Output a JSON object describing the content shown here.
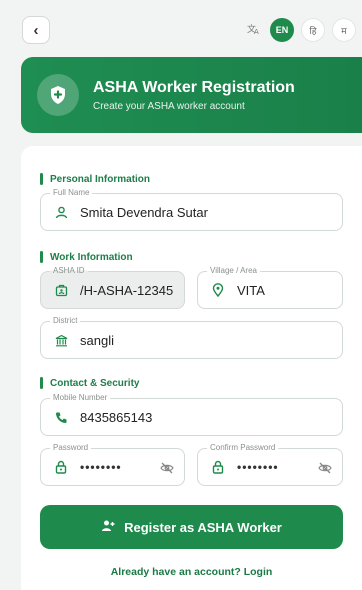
{
  "topbar": {
    "back_icon": "chevron-left-icon",
    "translate_icon": "translate-icon",
    "languages": [
      {
        "label": "EN",
        "active": true
      },
      {
        "label": "हि",
        "active": false
      },
      {
        "label": "म",
        "active": false
      }
    ]
  },
  "header": {
    "title": "ASHA Worker Registration",
    "subtitle": "Create your ASHA worker account",
    "icon": "shield-plus-icon"
  },
  "sections": {
    "personal": "Personal Information",
    "work": "Work Information",
    "contact": "Contact & Security"
  },
  "fields": {
    "full_name": {
      "label": "Full Name",
      "value": "Smita Devendra Sutar",
      "icon": "person-icon"
    },
    "asha_id": {
      "label": "ASHA ID",
      "value": "/H-ASHA-12345",
      "icon": "id-badge-icon"
    },
    "village": {
      "label": "Village / Area",
      "value": "VITA",
      "icon": "location-pin-icon"
    },
    "district": {
      "label": "District",
      "value": "sangli",
      "icon": "building-icon"
    },
    "mobile": {
      "label": "Mobile Number",
      "value": "8435865143",
      "icon": "phone-icon"
    },
    "password": {
      "label": "Password",
      "value": "••••••••",
      "icon": "lock-icon"
    },
    "confirm_password": {
      "label": "Confirm Password",
      "value": "••••••••",
      "icon": "lock-icon"
    }
  },
  "actions": {
    "register": "Register as ASHA Worker",
    "login_link": "Already have an account? Login"
  },
  "colors": {
    "primary": "#1e8a4c",
    "background": "#f2f4f3"
  }
}
